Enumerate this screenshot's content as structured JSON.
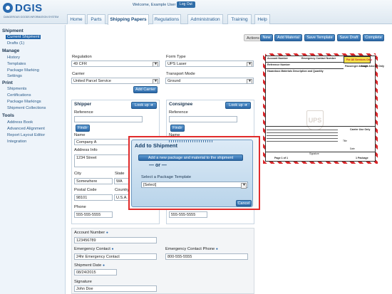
{
  "app": {
    "brand": "DGIS",
    "brand_sub": "DANGEROUS GOODS INFORMATION SYSTEM",
    "welcome": "Welcome, Example User",
    "logout": "Log Out"
  },
  "tabs": [
    "Home",
    "Parts",
    "Shipping Papers",
    "Regulations",
    "Administration",
    "Training",
    "Help"
  ],
  "active_tab": "Shipping Papers",
  "sidebar": {
    "shipment_header": "Shipment",
    "shipment_items": [
      "Current Shipment",
      "Drafts (1)"
    ],
    "manage_header": "Manage",
    "manage_items": [
      "History",
      "Templates",
      "Package Marking",
      "Settings"
    ],
    "print_header": "Print",
    "print_items": [
      "Shipments",
      "Certifications",
      "Package Markings",
      "Shipment Collections"
    ],
    "tools_header": "Tools",
    "tools_items": [
      "Address Book",
      "Advanced Alignment",
      "Report Layout Editor",
      "Integration"
    ]
  },
  "actions": {
    "label": "Actions",
    "new": "New",
    "add_material": "Add Material",
    "save_template": "Save Template",
    "save_draft": "Save Draft",
    "complete": "Complete"
  },
  "form": {
    "regulation_label": "Regulation",
    "regulation_value": "49 CFR",
    "form_type_label": "Form Type",
    "form_type_value": "UPS Laser",
    "carrier_label": "Carrier",
    "carrier_value": "United Parcel Service",
    "transport_label": "Transport Mode",
    "transport_value": "Ground",
    "add_carrier": "Add Carrier"
  },
  "shipper": {
    "title": "Shipper",
    "lookup": "Look up",
    "reference_label": "Reference",
    "find": "Find",
    "name_label": "Name",
    "name_value": "Company A",
    "address_label": "Address Info",
    "address_value": "1234 Street",
    "city_label": "City",
    "city_value": "Somewhere",
    "state_label": "State",
    "state_value": "WA",
    "postal_label": "Postal Code",
    "postal_value": "98101",
    "country_label": "Country",
    "country_value": "U.S.A.",
    "phone_label": "Phone",
    "phone_value": "555-555-5555"
  },
  "consignee": {
    "title": "Consignee",
    "lookup": "Look up",
    "reference_label": "Reference",
    "find": "Find",
    "name_label": "Name",
    "phone_value": "555-555-5555"
  },
  "bottom": {
    "account_label": "Account Number",
    "account_value": "123456789",
    "emergency_label": "Emergency Contact",
    "emergency_value": "24hr Emergency Contact",
    "emergency_phone_label": "Emergency Contact Phone",
    "emergency_phone_value": "800-555-5555",
    "ship_date_label": "Shipment Date",
    "ship_date_value": "08/24/2015",
    "signature_label": "Signature",
    "signature_value": "John Doe"
  },
  "modal": {
    "title": "Add to Shipment",
    "add_new": "Add a new package and material to the shipment",
    "or": "— or —",
    "select_label": "Select a Package Template",
    "select_value": "[Select]",
    "cancel": "Cancel"
  },
  "label_preview": {
    "account": "Account Number",
    "emergency": "Emergency Contact Number",
    "reference": "Reference Number",
    "hazmat": "Hazardous Materials Description and Quantity",
    "passenger": "Passenger Aircraft",
    "cargo": "Cargo Aircraft Only",
    "for_all": "For All Services Only",
    "logo": "UPS",
    "carrier_use": "Carrier Use Only",
    "signature": "Signature",
    "date": "Date",
    "page": "Page 1 of 1",
    "package": "1 Package",
    "title": "Title"
  },
  "colors": {
    "accent": "#2c68a8",
    "highlight_border": "#e12b2b",
    "hazmat_stripe": "#d9262a"
  }
}
